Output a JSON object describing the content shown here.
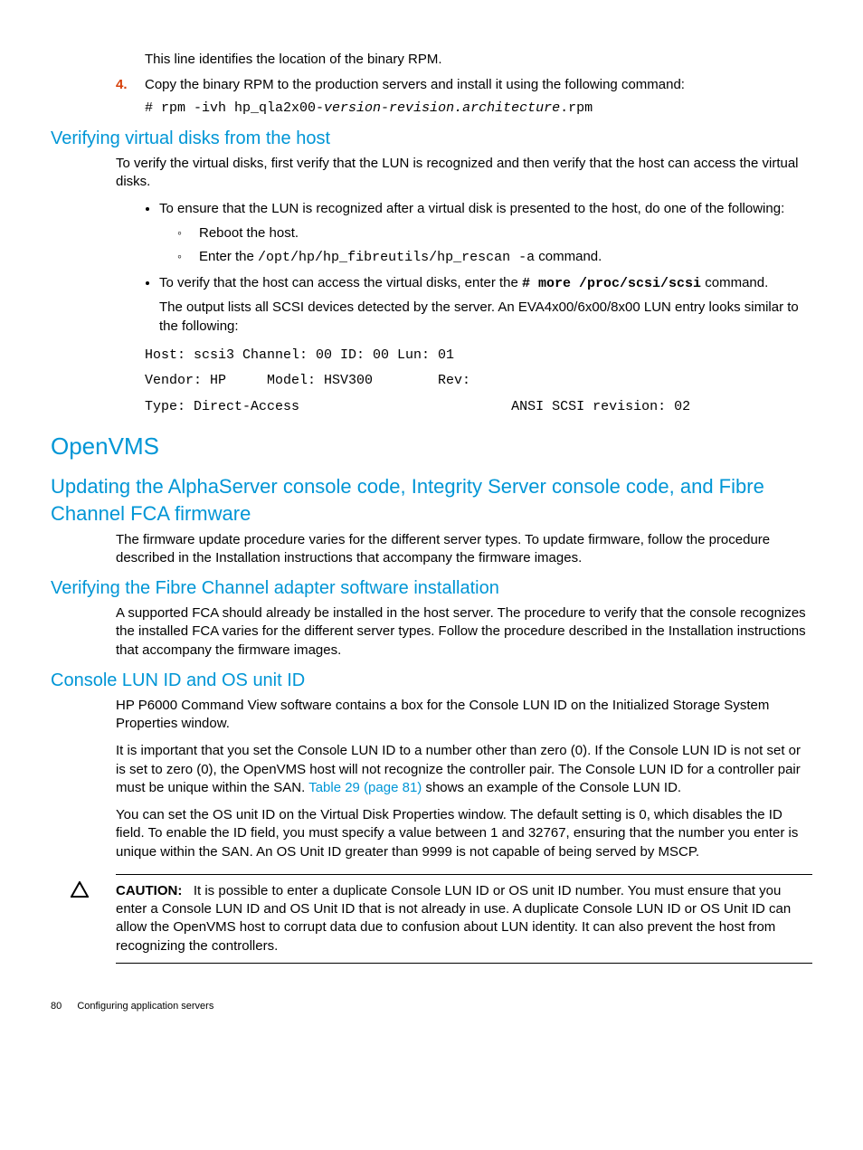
{
  "intro_line": "This line identifies the location of the binary RPM.",
  "step4_marker": "4.",
  "step4_text": "Copy the binary RPM to the production servers and install it using the following command:",
  "step4_cmd_pre": "# rpm -ivh hp_qla2x00-",
  "step4_cmd_i": "version-revision.architecture",
  "step4_cmd_post": ".rpm",
  "h_verify_vd": "Verifying virtual disks from the host",
  "verify_vd_p1": "To verify the virtual disks, first verify that the LUN is recognized and then verify that the host can access the virtual disks.",
  "verify_vd_b1": "To ensure that the LUN is recognized after a virtual disk is presented to the host, do one of the following:",
  "verify_vd_b1a": "Reboot the host.",
  "verify_vd_b1b_pre": "Enter the ",
  "verify_vd_b1b_cmd": "/opt/hp/hp_fibreutils/hp_rescan -a",
  "verify_vd_b1b_post": " command.",
  "verify_vd_b2_pre": "To verify that the host can access the virtual disks, enter the ",
  "verify_vd_b2_cmd": "# more /proc/scsi/scsi",
  "verify_vd_b2_post": " command.",
  "verify_vd_b2_p2": "The output lists all SCSI devices detected by the server. An EVA4x00/6x00/8x00 LUN entry looks similar to the following:",
  "verify_vd_code": "Host: scsi3 Channel: 00 ID: 00 Lun: 01\nVendor: HP     Model: HSV300        Rev:\nType: Direct-Access                          ANSI SCSI revision: 02",
  "h_openvms": "OpenVMS",
  "h_alpha": "Updating the AlphaServer console code, Integrity Server console code, and Fibre Channel FCA firmware",
  "alpha_p1": "The firmware update procedure varies for the different server types. To update firmware, follow the procedure described in the Installation instructions that accompany the firmware images.",
  "h_verify_fc": "Verifying the Fibre Channel adapter software installation",
  "verify_fc_p1": "A supported FCA should already be installed in the host server. The procedure to verify that the console recognizes the installed FCA varies for the different server types. Follow the procedure described in the Installation instructions that accompany the firmware images.",
  "h_console": "Console LUN ID and OS unit ID",
  "console_p1": "HP P6000 Command View software contains a box for the Console LUN ID on the Initialized Storage System Properties window.",
  "console_p2_pre": "It is important that you set the Console LUN ID to a number other than zero (0). If the Console LUN ID is not set or is set to zero (0), the OpenVMS host will not recognize the controller pair. The Console LUN ID for a controller pair must be unique within the SAN. ",
  "console_p2_link": "Table 29 (page 81)",
  "console_p2_post": " shows an example of the Console LUN ID.",
  "console_p3": "You can set the OS unit ID on the Virtual Disk Properties window. The default setting is 0, which disables the ID field. To enable the ID field, you must specify a value between 1 and 32767, ensuring that the number you enter is unique within the SAN. An OS Unit ID greater than 9999 is not capable of being served by MSCP.",
  "caution_label": "CAUTION:",
  "caution_text": "It is possible to enter a duplicate Console LUN ID or OS unit ID number. You must ensure that you enter a Console LUN ID and OS Unit ID that is not already in use. A duplicate Console LUN ID or OS Unit ID can allow the OpenVMS host to corrupt data due to confusion about LUN identity. It can also prevent the host from recognizing the controllers.",
  "footer_page": "80",
  "footer_title": "Configuring application servers"
}
